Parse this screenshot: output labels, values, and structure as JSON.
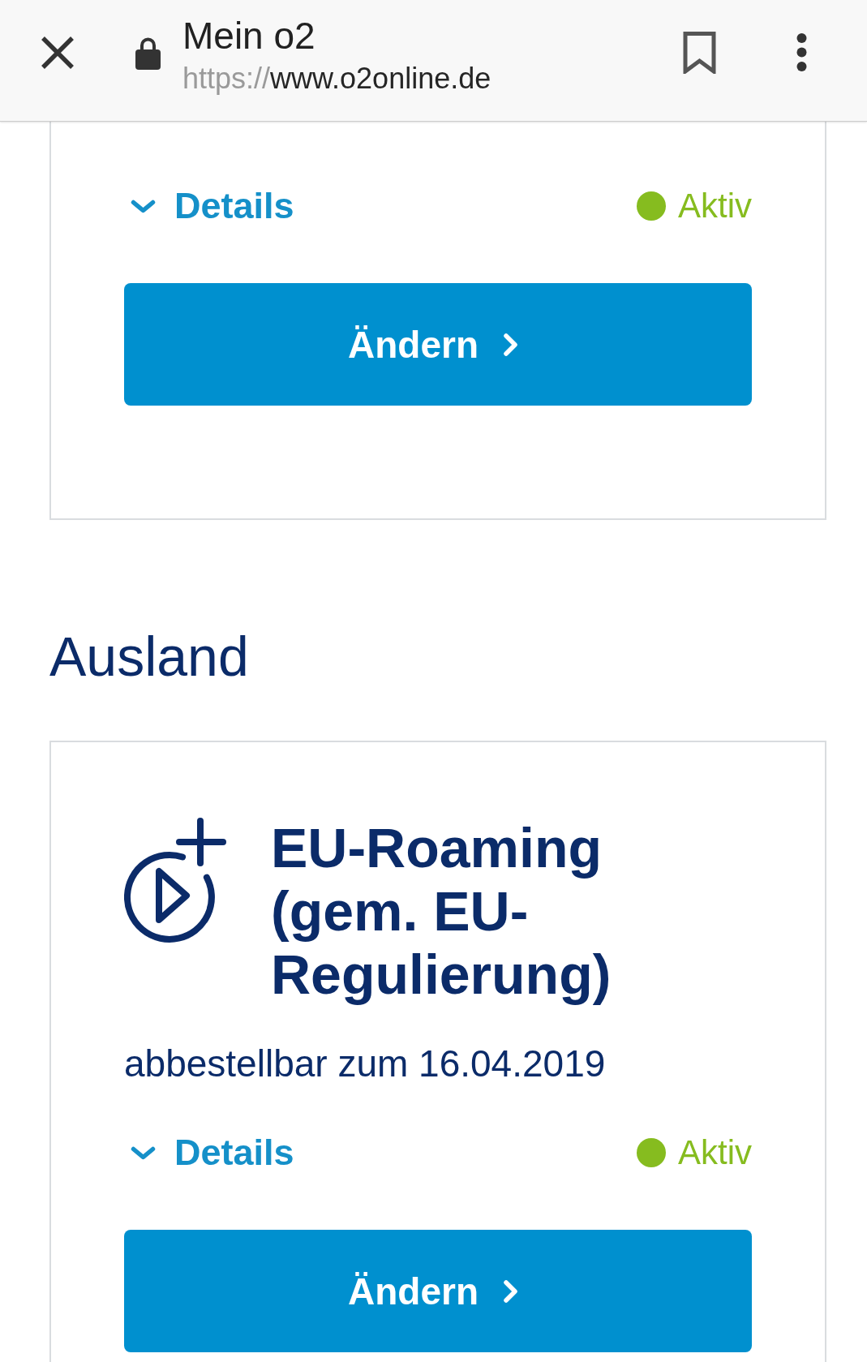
{
  "browser_bar": {
    "title": "Mein o2",
    "url": {
      "scheme": "https://",
      "host": "www.o2online.de"
    }
  },
  "sections": [
    {
      "cards": [
        {
          "details": {
            "label": "Details",
            "expanded": false
          },
          "status": {
            "label": "Aktiv",
            "color": "#86bc1f"
          },
          "button": "Ändern"
        }
      ]
    },
    {
      "heading": "Ausland",
      "cards": [
        {
          "title": "EU-Roaming (gem. EU-Regulierung)",
          "subtitle": "abbestellbar zum 16.04.2019",
          "details": {
            "label": "Details",
            "expanded": false
          },
          "status": {
            "label": "Aktiv",
            "color": "#86bc1f"
          },
          "button": "Ändern"
        }
      ]
    }
  ]
}
